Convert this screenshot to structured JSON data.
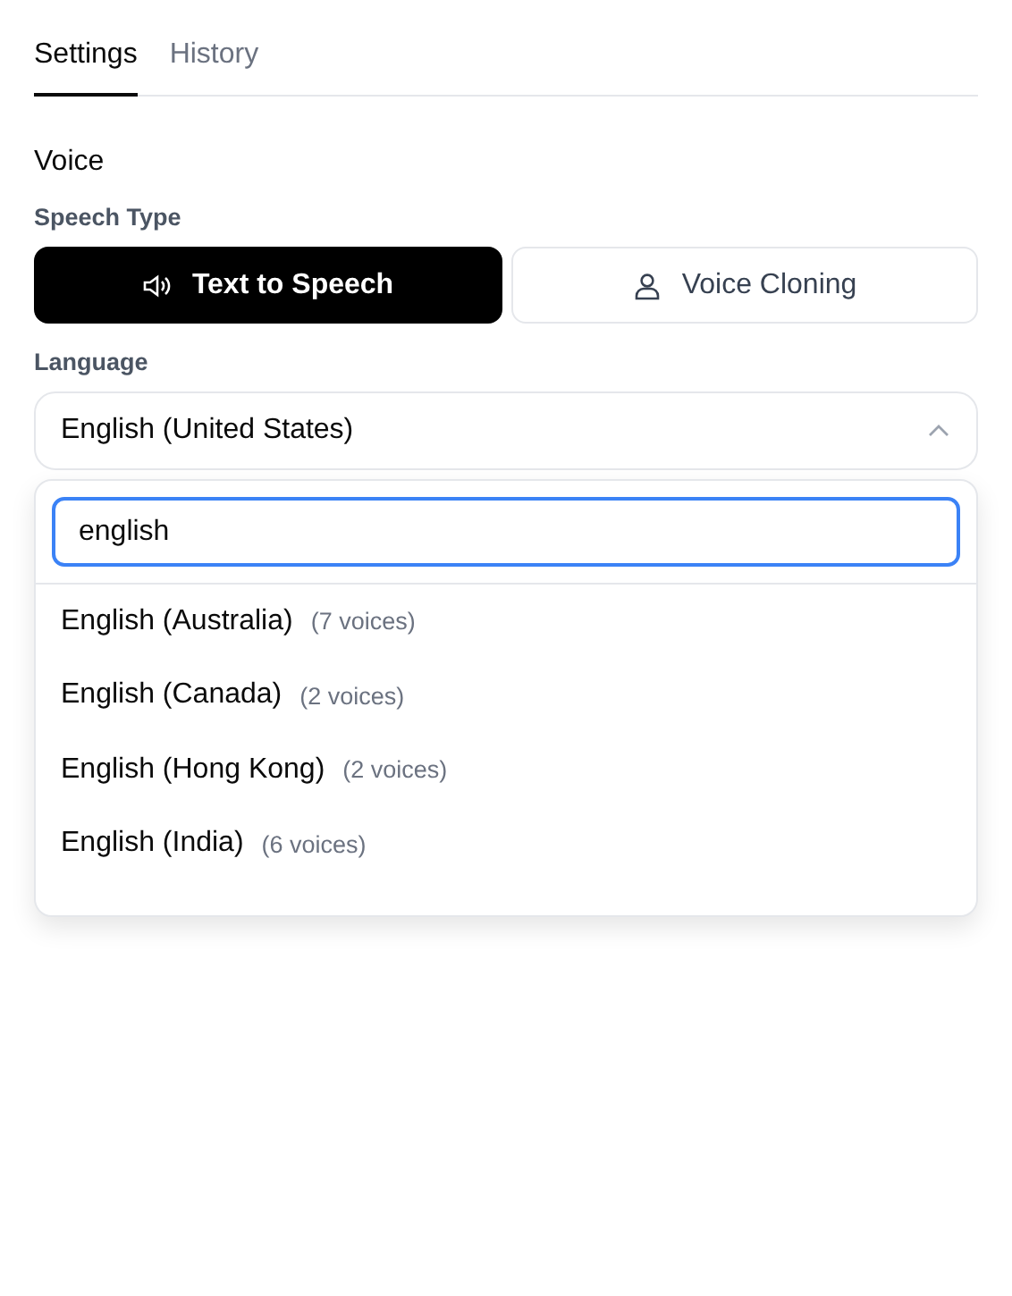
{
  "tabs": [
    {
      "label": "Settings",
      "selected": true
    },
    {
      "label": "History",
      "selected": false
    }
  ],
  "section_title": "Voice",
  "speech_type": {
    "label": "Speech Type",
    "options": [
      {
        "label": "Text to Speech",
        "kind": "speaker",
        "selected": true
      },
      {
        "label": "Voice Cloning",
        "kind": "person",
        "selected": false
      }
    ]
  },
  "language": {
    "label": "Language",
    "value": "English (United States)",
    "expanded": true,
    "search": {
      "value": "english"
    },
    "options": [
      {
        "name": "English (Australia)",
        "count": "(7 voices)"
      },
      {
        "name": "English (Canada)",
        "count": "(2 voices)"
      },
      {
        "name": "English (Hong Kong)",
        "count": "(2 voices)"
      },
      {
        "name": "English (India)",
        "count": "(6 voices)"
      }
    ]
  }
}
